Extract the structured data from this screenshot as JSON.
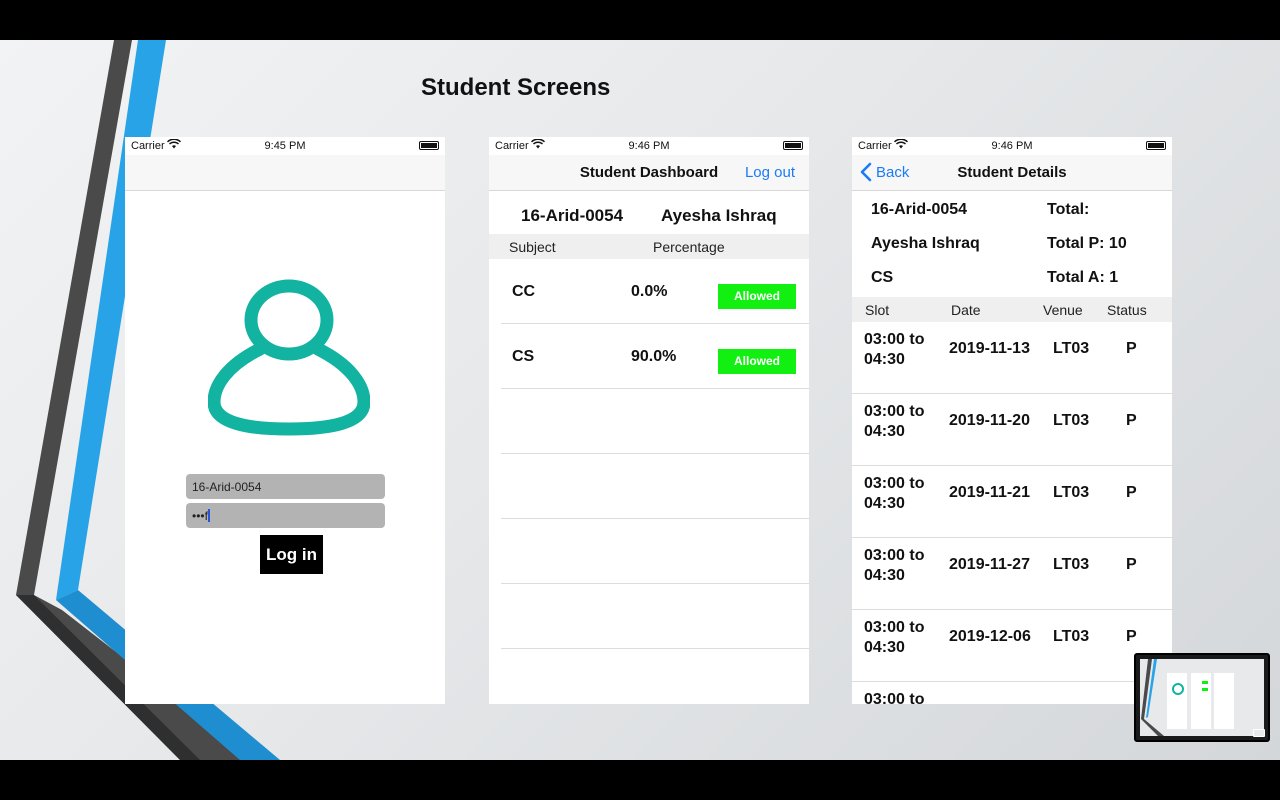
{
  "slide": {
    "title": "Student Screens"
  },
  "status_bar": {
    "carrier": "Carrier",
    "wifi_icon": "wifi-icon",
    "battery_icon": "battery-icon",
    "times": [
      "9:45 PM",
      "9:46 PM",
      "9:46 PM"
    ]
  },
  "login": {
    "avatar_icon": "user-avatar-icon",
    "avatar_color": "#12b3a0",
    "username": "16-Arid-0054",
    "password_mask": "•••f",
    "login_label": "Log in"
  },
  "dashboard": {
    "title": "Student Dashboard",
    "logout_label": "Log out",
    "student_id": "16-Arid-0054",
    "student_name": "Ayesha Ishraq",
    "header": {
      "subject": "Subject",
      "percentage": "Percentage"
    },
    "rows": [
      {
        "subject": "CC",
        "percentage": "0.0%",
        "status": "Allowed"
      },
      {
        "subject": "CS",
        "percentage": "90.0%",
        "status": "Allowed"
      }
    ],
    "badge_color": "#12f012"
  },
  "details": {
    "back_label": "Back",
    "title": "Student Details",
    "student_id": "16-Arid-0054",
    "student_name": "Ayesha Ishraq",
    "subject": "CS",
    "total_label": "Total:",
    "total_p": "Total P: 10",
    "total_a": "Total A: 1",
    "header": {
      "slot": "Slot",
      "date": "Date",
      "venue": "Venue",
      "status": "Status"
    },
    "rows": [
      {
        "slot_start": "03:00 to",
        "slot_end": "04:30",
        "date": "2019-11-13",
        "venue": "LT03",
        "status": "P"
      },
      {
        "slot_start": "03:00 to",
        "slot_end": "04:30",
        "date": "2019-11-20",
        "venue": "LT03",
        "status": "P"
      },
      {
        "slot_start": "03:00 to",
        "slot_end": "04:30",
        "date": "2019-11-21",
        "venue": "LT03",
        "status": "P"
      },
      {
        "slot_start": "03:00 to",
        "slot_end": "04:30",
        "date": "2019-11-27",
        "venue": "LT03",
        "status": "P"
      },
      {
        "slot_start": "03:00 to",
        "slot_end": "04:30",
        "date": "2019-12-06",
        "venue": "LT03",
        "status": "P"
      },
      {
        "slot_start": "03:00 to",
        "slot_end": "",
        "date": "",
        "venue": "",
        "status": ""
      }
    ]
  },
  "thumbnail": {
    "icon": "slide-thumbnail"
  }
}
